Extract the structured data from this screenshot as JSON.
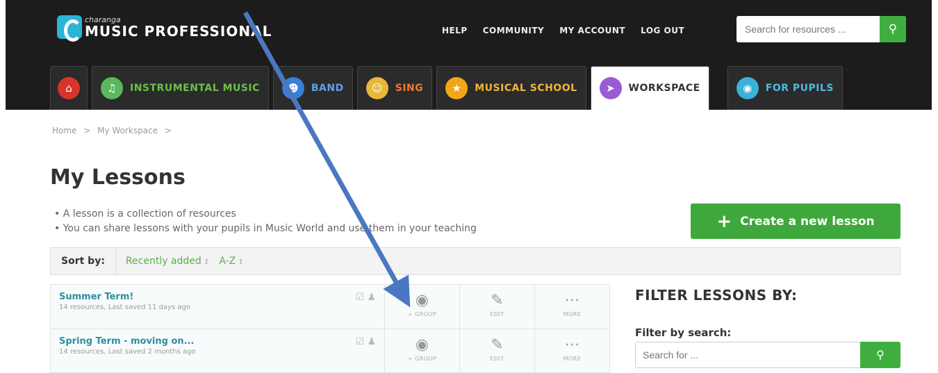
{
  "brand": {
    "small": "charanga",
    "big": "MUSIC PROFESSIONAL"
  },
  "topnav": [
    "HELP",
    "COMMUNITY",
    "MY ACCOUNT",
    "LOG OUT"
  ],
  "search_top": {
    "placeholder": "Search for resources ..."
  },
  "tabs": [
    {
      "label": "",
      "icon": "home-icon",
      "color": "#d9342b"
    },
    {
      "label": "INSTRUMENTAL MUSIC",
      "icon": "music-icon",
      "color": "#5cb85c"
    },
    {
      "label": "BAND",
      "icon": "band-icon",
      "color": "#3a7fd5"
    },
    {
      "label": "SING",
      "icon": "sing-icon",
      "color": "#e8b838"
    },
    {
      "label": "MUSICAL SCHOOL",
      "icon": "school-icon",
      "color": "#f0a81a"
    },
    {
      "label": "WORKSPACE",
      "icon": "pin-icon",
      "color": "#9b5ad6"
    },
    {
      "label": "FOR PUPILS",
      "icon": "globe-icon",
      "color": "#3bb0d9"
    }
  ],
  "breadcrumb": [
    "Home",
    "My Workspace"
  ],
  "page_title": "My Lessons",
  "bullets": [
    "A lesson is a collection of resources",
    "You can share lessons with your pupils in Music World and use them in your teaching"
  ],
  "create_button": "Create a new lesson",
  "sort": {
    "label": "Sort by:",
    "options": [
      "Recently added",
      "A-Z"
    ]
  },
  "lessons": [
    {
      "name": "Summer Term!",
      "meta": "14 resources, Last saved 11 days ago"
    },
    {
      "name": "Spring Term - moving on...",
      "meta": "14 resources, Last saved 2 months ago"
    }
  ],
  "actions": {
    "group": "+ GROUP",
    "edit": "EDIT",
    "more": "MORE"
  },
  "filter": {
    "title": "FILTER LESSONS BY:",
    "label": "Filter by search:",
    "placeholder": "Search for ..."
  }
}
